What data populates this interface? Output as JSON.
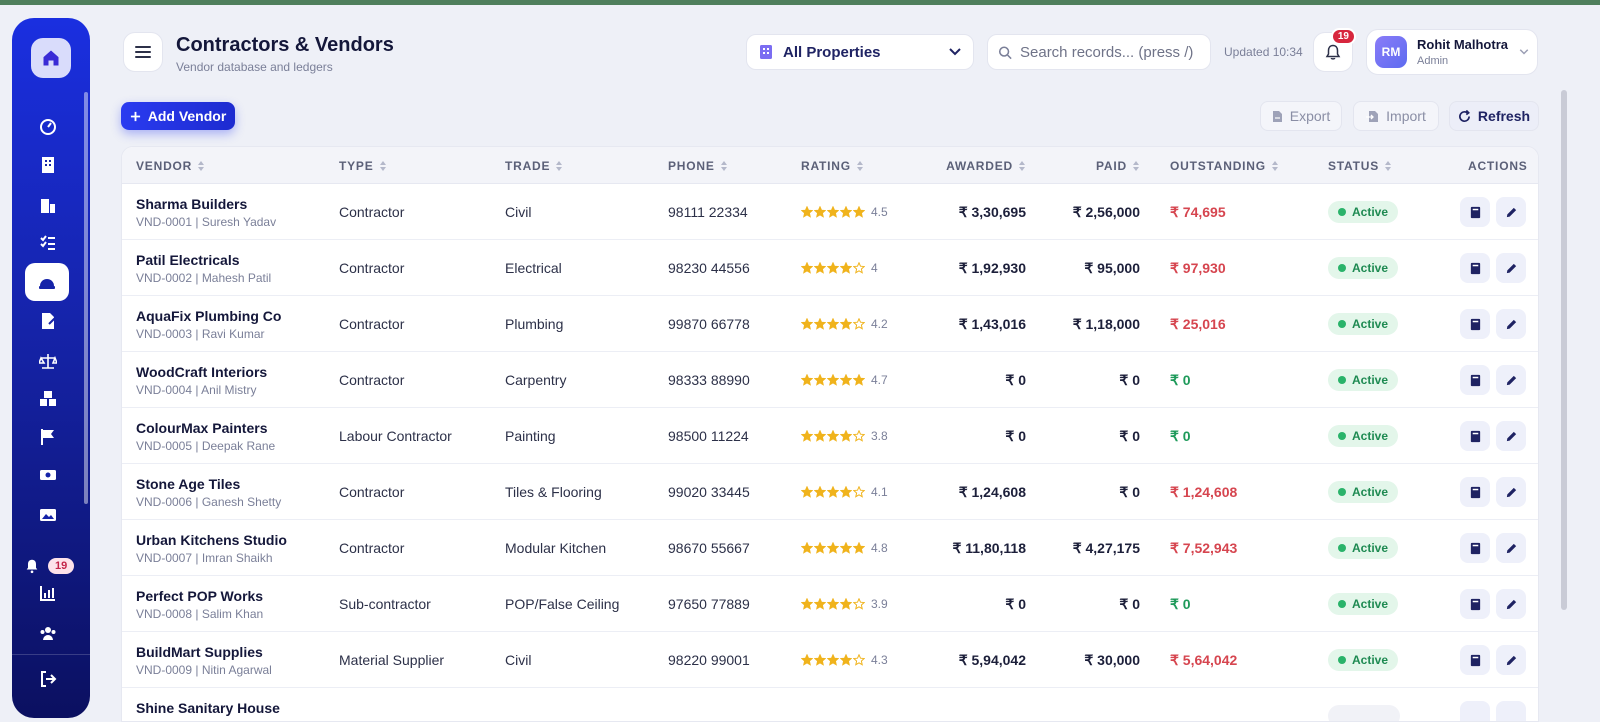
{
  "header": {
    "title": "Contractors & Vendors",
    "subtitle": "Vendor database and ledgers",
    "property_select": "All Properties",
    "search_placeholder": "Search records... (press /)",
    "updated": "Updated 10:34",
    "notifications_count": "19",
    "user": {
      "initials": "RM",
      "name": "Rohit Malhotra",
      "role": "Admin"
    }
  },
  "sidebar": {
    "notifications_badge": "19",
    "items": [
      "dashboard",
      "buildings",
      "properties",
      "tasks",
      "contractors",
      "documents",
      "legal",
      "inventory",
      "milestones",
      "payments",
      "gallery",
      "notifications",
      "reports",
      "team",
      "logout"
    ]
  },
  "toolbar": {
    "add": "Add Vendor",
    "export": "Export",
    "import": "Import",
    "refresh": "Refresh"
  },
  "table": {
    "columns": [
      "VENDOR",
      "TYPE",
      "TRADE",
      "PHONE",
      "RATING",
      "AWARDED",
      "PAID",
      "OUTSTANDING",
      "STATUS",
      "ACTIONS"
    ],
    "rows": [
      {
        "name": "Sharma Builders",
        "meta": "VND-0001 | Suresh Yadav",
        "type": "Contractor",
        "trade": "Civil",
        "phone": "98111 22334",
        "stars": 5,
        "rating": "4.5",
        "awarded": "₹ 3,30,695",
        "paid": "₹ 2,56,000",
        "outstanding": "₹ 74,695",
        "due": true,
        "status": "Active"
      },
      {
        "name": "Patil Electricals",
        "meta": "VND-0002 | Mahesh Patil",
        "type": "Contractor",
        "trade": "Electrical",
        "phone": "98230 44556",
        "stars": 4,
        "rating": "4",
        "awarded": "₹ 1,92,930",
        "paid": "₹ 95,000",
        "outstanding": "₹ 97,930",
        "due": true,
        "status": "Active"
      },
      {
        "name": "AquaFix Plumbing Co",
        "meta": "VND-0003 | Ravi Kumar",
        "type": "Contractor",
        "trade": "Plumbing",
        "phone": "99870 66778",
        "stars": 4,
        "rating": "4.2",
        "awarded": "₹ 1,43,016",
        "paid": "₹ 1,18,000",
        "outstanding": "₹ 25,016",
        "due": true,
        "status": "Active"
      },
      {
        "name": "WoodCraft Interiors",
        "meta": "VND-0004 | Anil Mistry",
        "type": "Contractor",
        "trade": "Carpentry",
        "phone": "98333 88990",
        "stars": 5,
        "rating": "4.7",
        "awarded": "₹ 0",
        "paid": "₹ 0",
        "outstanding": "₹ 0",
        "due": false,
        "status": "Active"
      },
      {
        "name": "ColourMax Painters",
        "meta": "VND-0005 | Deepak Rane",
        "type": "Labour Contractor",
        "trade": "Painting",
        "phone": "98500 11224",
        "stars": 4,
        "rating": "3.8",
        "awarded": "₹ 0",
        "paid": "₹ 0",
        "outstanding": "₹ 0",
        "due": false,
        "status": "Active"
      },
      {
        "name": "Stone Age Tiles",
        "meta": "VND-0006 | Ganesh Shetty",
        "type": "Contractor",
        "trade": "Tiles & Flooring",
        "phone": "99020 33445",
        "stars": 4,
        "rating": "4.1",
        "awarded": "₹ 1,24,608",
        "paid": "₹ 0",
        "outstanding": "₹ 1,24,608",
        "due": true,
        "status": "Active"
      },
      {
        "name": "Urban Kitchens Studio",
        "meta": "VND-0007 | Imran Shaikh",
        "type": "Contractor",
        "trade": "Modular Kitchen",
        "phone": "98670 55667",
        "stars": 5,
        "rating": "4.8",
        "awarded": "₹ 11,80,118",
        "paid": "₹ 4,27,175",
        "outstanding": "₹ 7,52,943",
        "due": true,
        "status": "Active"
      },
      {
        "name": "Perfect POP Works",
        "meta": "VND-0008 | Salim Khan",
        "type": "Sub-contractor",
        "trade": "POP/False Ceiling",
        "phone": "97650 77889",
        "stars": 4,
        "rating": "3.9",
        "awarded": "₹ 0",
        "paid": "₹ 0",
        "outstanding": "₹ 0",
        "due": false,
        "status": "Active"
      },
      {
        "name": "BuildMart Supplies",
        "meta": "VND-0009 | Nitin Agarwal",
        "type": "Material Supplier",
        "trade": "Civil",
        "phone": "98220 99001",
        "stars": 4,
        "rating": "4.3",
        "awarded": "₹ 5,94,042",
        "paid": "₹ 30,000",
        "outstanding": "₹ 5,64,042",
        "due": true,
        "status": "Active"
      },
      {
        "name": "Shine Sanitary House",
        "meta": "",
        "type": "",
        "trade": "",
        "phone": "",
        "stars": 0,
        "rating": "",
        "awarded": "",
        "paid": "",
        "outstanding": "",
        "due": false,
        "status": ""
      }
    ]
  },
  "colors": {
    "accent": "#2a3bf0",
    "sidebar": "#1523a8",
    "star": "#f0b31c",
    "due": "#d6454f",
    "clear": "#1e9a5a",
    "active": "#2ab36a"
  }
}
